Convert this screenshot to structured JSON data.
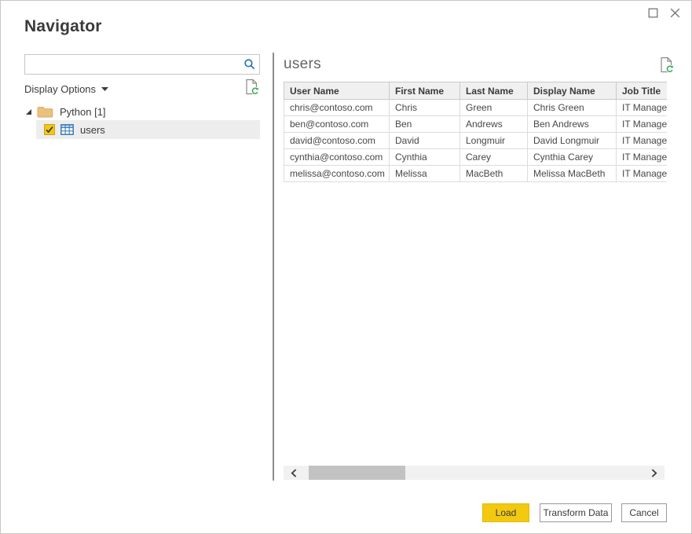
{
  "window": {
    "title": "Navigator"
  },
  "search": {
    "value": "",
    "placeholder": ""
  },
  "display_options": {
    "label": "Display Options"
  },
  "tree": {
    "root": {
      "label": "Python [1]",
      "expanded": true
    },
    "child": {
      "label": "users",
      "checked": true,
      "selected": true
    }
  },
  "preview": {
    "title": "users",
    "columns": [
      "User Name",
      "First Name",
      "Last Name",
      "Display Name",
      "Job Title"
    ],
    "rows": [
      [
        "chris@contoso.com",
        "Chris",
        "Green",
        "Chris Green",
        "IT Manager"
      ],
      [
        "ben@contoso.com",
        "Ben",
        "Andrews",
        "Ben Andrews",
        "IT Manager"
      ],
      [
        "david@contoso.com",
        "David",
        "Longmuir",
        "David Longmuir",
        "IT Manager"
      ],
      [
        "cynthia@contoso.com",
        "Cynthia",
        "Carey",
        "Cynthia Carey",
        "IT Manager"
      ],
      [
        "melissa@contoso.com",
        "Melissa",
        "MacBeth",
        "Melissa MacBeth",
        "IT Manager"
      ]
    ]
  },
  "buttons": {
    "load": "Load",
    "transform": "Transform Data",
    "cancel": "Cancel"
  },
  "icons": {
    "titlebar": [
      "maximize-icon",
      "close-icon"
    ],
    "search": "search-icon",
    "refresh": "refresh-document-icon",
    "tree": [
      "expander-triangle-icon",
      "folder-icon",
      "checkbox-checked",
      "table-grid-icon"
    ],
    "scrollbar": [
      "chevron-left-icon",
      "chevron-right-icon"
    ]
  },
  "colors": {
    "accent_yellow": "#F2C811",
    "refresh_green": "#3BA755",
    "icon_blue": "#2E75B6",
    "folder_tan": "#EAC27D",
    "selection_gray": "#EDEDED",
    "divider_gray": "#8C8C8C"
  }
}
